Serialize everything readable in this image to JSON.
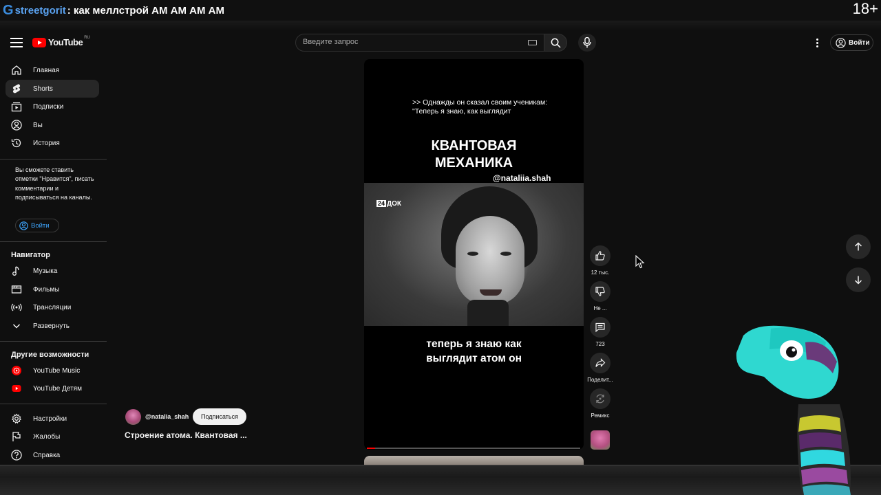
{
  "stream": {
    "g_logo": "G",
    "channel": "streetgorit",
    "title": ": как меллстрой АМ АМ АМ АМ",
    "age_rating": "18+"
  },
  "masthead": {
    "logo_text": "YouTube",
    "logo_region": "RU",
    "search_placeholder": "Введите запрос",
    "signin_label": "Войти"
  },
  "sidebar": {
    "items": [
      {
        "label": "Главная",
        "icon": "home-icon"
      },
      {
        "label": "Shorts",
        "icon": "shorts-icon",
        "active": true
      },
      {
        "label": "Подписки",
        "icon": "subscriptions-icon"
      },
      {
        "label": "Вы",
        "icon": "you-icon"
      },
      {
        "label": "История",
        "icon": "history-icon"
      }
    ],
    "signin_note": "Вы сможете ставить отметки \"Нравится\", писать комментарии и подписываться на каналы.",
    "signin_label": "Войти",
    "navigator_heading": "Навигатор",
    "navigator_items": [
      {
        "label": "Музыка",
        "icon": "music-icon"
      },
      {
        "label": "Фильмы",
        "icon": "films-icon"
      },
      {
        "label": "Трансляции",
        "icon": "live-icon"
      },
      {
        "label": "Развернуть",
        "icon": "chevron-down-icon"
      }
    ],
    "more_heading": "Другие возможности",
    "more_items": [
      {
        "label": "YouTube Music",
        "icon": "youtube-music-icon"
      },
      {
        "label": "YouTube Детям",
        "icon": "youtube-kids-icon"
      }
    ],
    "footer_items": [
      {
        "label": "Настройки",
        "icon": "settings-icon"
      },
      {
        "label": "Жалобы",
        "icon": "flag-icon"
      },
      {
        "label": "Справка",
        "icon": "help-icon"
      }
    ]
  },
  "short": {
    "caption_line1": ">> Однажды он сказал своим ученикам:",
    "caption_line2": "\"Теперь я знаю, как выглядит",
    "title_line1": "КВАНТОВАЯ",
    "title_line2": "МЕХАНИКА",
    "handle_overlay": "@nataliia.shah",
    "broadcaster_logo_box": "24",
    "broadcaster_logo_text": "ДОК",
    "subtitle_line1": "теперь я знаю как",
    "subtitle_line2": "выглядит атом он",
    "progress": 0.04,
    "channel_name": "@natalia_shah",
    "subscribe_label": "Подписаться",
    "video_title": "Строение атома. Квантовая ..."
  },
  "actions": {
    "like_count": "12 тыс.",
    "dislike_label": "Не ...",
    "comments_count": "723",
    "share_label": "Поделит...",
    "remix_label": "Ремикс"
  },
  "colors": {
    "background": "#0f0f0f",
    "accent_red": "#ff0000",
    "link_blue": "#3ea6ff",
    "stream_user": "#5aa2f0"
  }
}
